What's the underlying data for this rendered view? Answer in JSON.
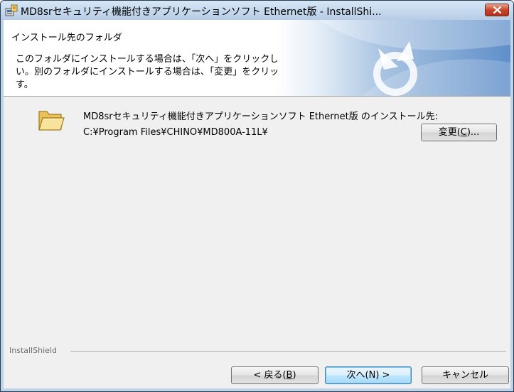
{
  "window": {
    "title": "MD8srセキュリティ機能付きアプリケーションソフト Ethernet版 - InstallShi..."
  },
  "header": {
    "title": "インストール先のフォルダ",
    "description": "このフォルダにインストールする場合は、「次へ」をクリックしてください。別のフォルダにインストールする場合は、「変更」をクリックします。"
  },
  "destination": {
    "label": "MD8srセキュリティ機能付きアプリケーションソフト Ethernet版 のインストール先:",
    "path": "C:¥Program Files¥CHINO¥MD800A-11L¥",
    "change_button": {
      "pre": "変更(",
      "mnemonic": "C",
      "post": ")..."
    }
  },
  "footer": {
    "brand": "InstallShield",
    "back_button": {
      "pre": "< 戻る(",
      "mnemonic": "B",
      "post": ")"
    },
    "next_button": "次へ(N) >",
    "cancel_button": "キャンセル"
  },
  "icons": {
    "app": "installer-icon",
    "folder": "folder-icon",
    "close": "close-icon"
  },
  "colors": {
    "header_background": "#ffffff",
    "body_background": "#f0f0f0",
    "close_button": "#c8452b",
    "default_button_border": "#3c7fb1"
  }
}
